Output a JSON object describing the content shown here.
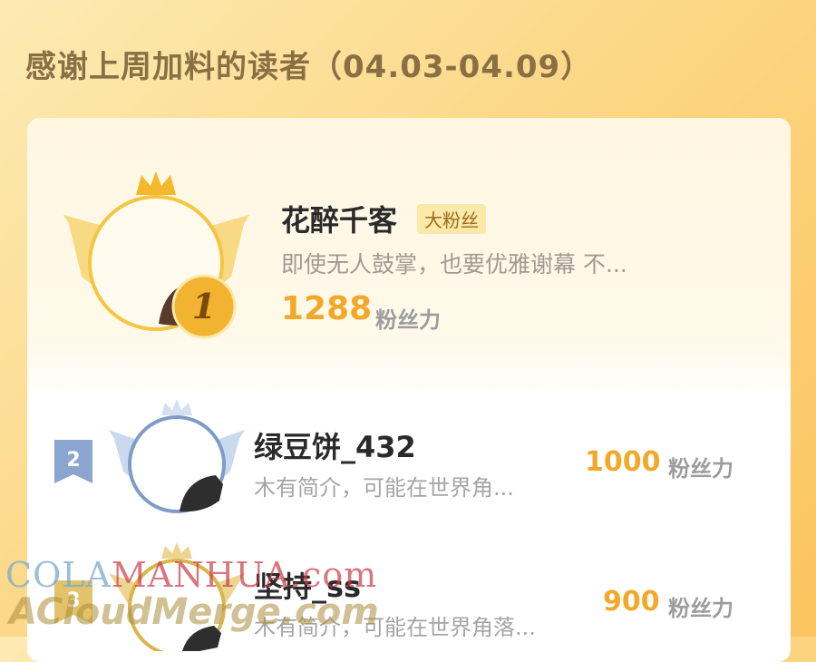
{
  "header": {
    "title": "感谢上周加料的读者（04.03-04.09）"
  },
  "leaderboard": {
    "top": {
      "rank": "1",
      "name": "花醉千客",
      "badge": "大粉丝",
      "bio": "即使无人鼓掌，也要优雅谢幕 不...",
      "score": "1288",
      "score_label": "粉丝力",
      "ring_color": "#f5c542",
      "wing_color": "#f8d67a"
    },
    "rows": [
      {
        "rank": "2",
        "name": "绿豆饼_432",
        "bio": "木有简介，可能在世界角...",
        "score": "1000",
        "score_label": "粉丝力",
        "ring_color": "#7f9cc7",
        "wing_color": "#c9d9ee"
      },
      {
        "rank": "3",
        "name": "坚持_ss",
        "bio": "木有简介，可能在世界角落...",
        "score": "900",
        "score_label": "粉丝力",
        "ring_color": "#d9b64a",
        "wing_color": "#ecd58f"
      }
    ]
  },
  "watermark": {
    "line1_a": "COLA",
    "line1_b": "MANHUA",
    "line1_c": ".com",
    "line2": "ACloudMerge.com"
  }
}
